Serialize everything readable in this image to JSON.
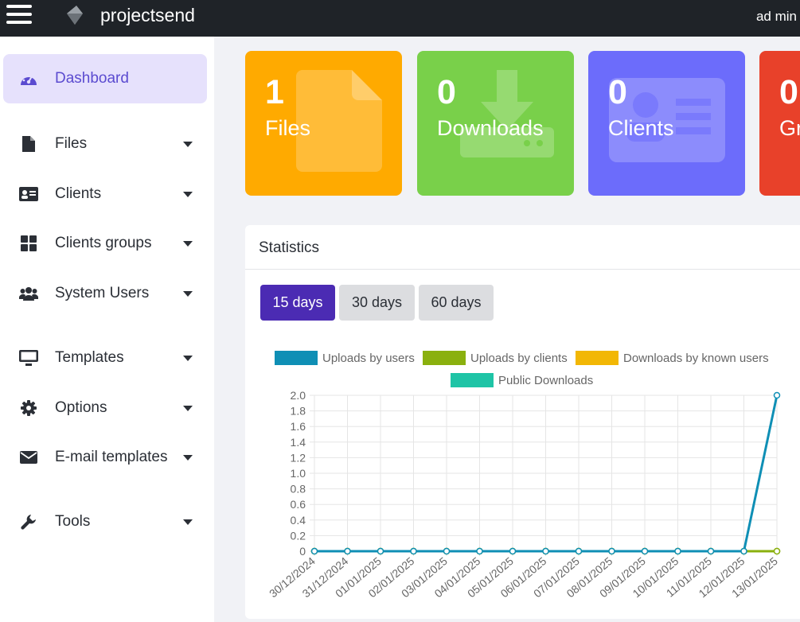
{
  "topbar": {
    "brand": "projectsend",
    "user": "ad min"
  },
  "sidebar": {
    "items": [
      {
        "label": "Dashboard",
        "icon": "dashboard-icon",
        "active": true
      },
      {
        "label": "Files",
        "icon": "file-icon"
      },
      {
        "label": "Clients",
        "icon": "id-card-icon"
      },
      {
        "label": "Clients groups",
        "icon": "grid-icon"
      },
      {
        "label": "System Users",
        "icon": "users-icon"
      },
      {
        "label": "Templates",
        "icon": "monitor-icon"
      },
      {
        "label": "Options",
        "icon": "gear-icon"
      },
      {
        "label": "E-mail templates",
        "icon": "envelope-icon"
      },
      {
        "label": "Tools",
        "icon": "wrench-icon"
      }
    ]
  },
  "cards": [
    {
      "value": "1",
      "label": "Files",
      "color": "#ffaa00"
    },
    {
      "value": "0",
      "label": "Downloads",
      "color": "#79d04a"
    },
    {
      "value": "0",
      "label": "Clients",
      "color": "#6c6cfb"
    },
    {
      "value": "0",
      "label": "Gr",
      "color": "#e8412a"
    }
  ],
  "statistics": {
    "title": "Statistics",
    "ranges": [
      "15 days",
      "30 days",
      "60 days"
    ]
  },
  "chart_data": {
    "type": "line",
    "title": "",
    "xlabel": "",
    "ylabel": "",
    "x": [
      "30/12/2024",
      "31/12/2024",
      "01/01/2025",
      "02/01/2025",
      "03/01/2025",
      "04/01/2025",
      "05/01/2025",
      "06/01/2025",
      "07/01/2025",
      "08/01/2025",
      "09/01/2025",
      "10/01/2025",
      "11/01/2025",
      "12/01/2025",
      "13/01/2025"
    ],
    "ylim": [
      0,
      2.0
    ],
    "yticks": [
      "2.0",
      "1.8",
      "1.6",
      "1.4",
      "1.2",
      "1.0",
      "0.8",
      "0.6",
      "0.4",
      "0.2",
      "0"
    ],
    "grid": true,
    "legend_position": "top",
    "series": [
      {
        "name": "Uploads by users",
        "color": "#0f8fb5",
        "values": [
          0,
          0,
          0,
          0,
          0,
          0,
          0,
          0,
          0,
          0,
          0,
          0,
          0,
          0,
          2
        ]
      },
      {
        "name": "Uploads by clients",
        "color": "#8ab00e",
        "values": [
          0,
          0,
          0,
          0,
          0,
          0,
          0,
          0,
          0,
          0,
          0,
          0,
          0,
          0,
          0
        ]
      },
      {
        "name": "Downloads by known users",
        "color": "#f2b705",
        "values": [
          0,
          0,
          0,
          0,
          0,
          0,
          0,
          0,
          0,
          0,
          0,
          0,
          0,
          0,
          0
        ]
      },
      {
        "name": "Public Downloads",
        "color": "#1fc4a6",
        "values": [
          0,
          0,
          0,
          0,
          0,
          0,
          0,
          0,
          0,
          0,
          0,
          0,
          0,
          0,
          0
        ]
      }
    ]
  }
}
